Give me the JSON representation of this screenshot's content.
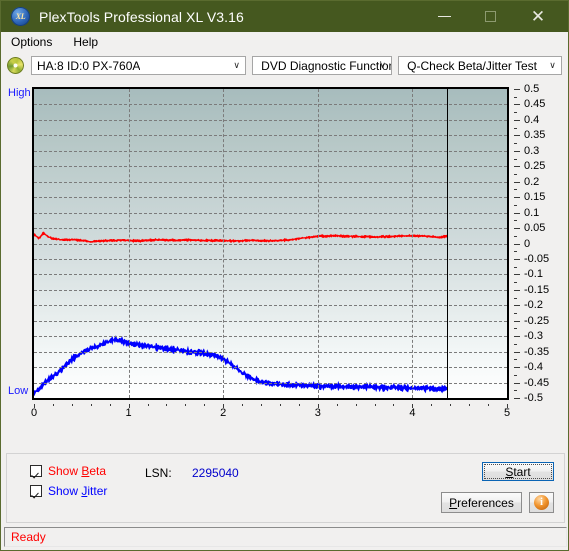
{
  "window": {
    "title": "PlexTools Professional XL V3.16",
    "app_icon": "xl-disc-icon",
    "icon_text": "XL",
    "minimize_label": "—",
    "maximize_label": "□",
    "close_label": "✕",
    "titlebar_color": "#45581f"
  },
  "menu": {
    "items": [
      {
        "label": "Options"
      },
      {
        "label": "Help"
      }
    ]
  },
  "toolbar": {
    "drive_icon": "disc-icon",
    "drive_select": {
      "value": "HA:8 ID:0  PX-760A",
      "arrow": "∨"
    },
    "function_select": {
      "value": "DVD Diagnostic Functions",
      "arrow": "∨"
    },
    "test_select": {
      "value": "Q-Check Beta/Jitter Test",
      "arrow": "∨"
    }
  },
  "chart_labels": {
    "high": "High",
    "low": "Low"
  },
  "chart_data": {
    "type": "line",
    "title": "Q-Check Beta/Jitter Test",
    "xlabel": "",
    "ylabel": "",
    "xlim": [
      0,
      5
    ],
    "ylim": [
      -0.5,
      0.5
    ],
    "grid": true,
    "legend_position": "below-left",
    "x_ticks": [
      0,
      1,
      2,
      3,
      4,
      5
    ],
    "x_tick_labels": [
      "0",
      "1",
      "2",
      "3",
      "4",
      "5"
    ],
    "y_ticks": [
      0.5,
      0.45,
      0.4,
      0.35,
      0.3,
      0.25,
      0.2,
      0.15,
      0.1,
      0.05,
      0,
      -0.05,
      -0.1,
      -0.15,
      -0.2,
      -0.25,
      -0.3,
      -0.35,
      -0.4,
      -0.45,
      -0.5
    ],
    "y_tick_labels": [
      "0.5",
      "0.45",
      "0.4",
      "0.35",
      "0.3",
      "0.25",
      "0.2",
      "0.15",
      "0.1",
      "0.05",
      "0",
      "-0.05",
      "-0.1",
      "-0.15",
      "-0.2",
      "-0.25",
      "-0.3",
      "-0.35",
      "-0.4",
      "-0.45",
      "-0.5"
    ],
    "data_end_x": 4.37,
    "annotations": [
      {
        "type": "vline",
        "x": 4.37,
        "color": "#000000",
        "label": "data end marker"
      }
    ],
    "series": [
      {
        "name": "Beta",
        "color": "#ff0000",
        "x": [
          0.0,
          0.05,
          0.1,
          0.15,
          0.2,
          0.3,
          0.4,
          0.5,
          0.6,
          0.7,
          0.8,
          0.9,
          1.0,
          1.1,
          1.2,
          1.3,
          1.4,
          1.5,
          1.6,
          1.7,
          1.8,
          1.9,
          2.0,
          2.1,
          2.2,
          2.3,
          2.4,
          2.5,
          2.6,
          2.7,
          2.8,
          2.9,
          3.0,
          3.1,
          3.2,
          3.3,
          3.4,
          3.5,
          3.6,
          3.7,
          3.8,
          3.9,
          4.0,
          4.1,
          4.2,
          4.3,
          4.37
        ],
        "values": [
          0.03,
          0.016,
          0.034,
          0.022,
          0.016,
          0.012,
          0.013,
          0.01,
          0.006,
          0.008,
          0.009,
          0.011,
          0.01,
          0.008,
          0.01,
          0.012,
          0.011,
          0.01,
          0.012,
          0.011,
          0.01,
          0.01,
          0.009,
          0.008,
          0.009,
          0.01,
          0.009,
          0.008,
          0.01,
          0.012,
          0.016,
          0.02,
          0.023,
          0.024,
          0.025,
          0.024,
          0.023,
          0.022,
          0.021,
          0.022,
          0.023,
          0.024,
          0.025,
          0.024,
          0.022,
          0.02,
          0.024
        ],
        "noise_amplitude": 0.011
      },
      {
        "name": "Jitter",
        "color": "#0000ff",
        "x": [
          0.0,
          0.05,
          0.1,
          0.15,
          0.2,
          0.25,
          0.3,
          0.35,
          0.4,
          0.45,
          0.5,
          0.55,
          0.6,
          0.65,
          0.7,
          0.75,
          0.8,
          0.85,
          0.9,
          0.95,
          1.0,
          1.1,
          1.2,
          1.3,
          1.4,
          1.5,
          1.6,
          1.7,
          1.8,
          1.9,
          2.0,
          2.1,
          2.2,
          2.3,
          2.4,
          2.5,
          2.6,
          2.7,
          2.8,
          2.9,
          3.0,
          3.1,
          3.2,
          3.3,
          3.4,
          3.5,
          3.6,
          3.7,
          3.8,
          3.9,
          4.0,
          4.1,
          4.2,
          4.3,
          4.37
        ],
        "values": [
          -0.485,
          -0.47,
          -0.455,
          -0.44,
          -0.43,
          -0.42,
          -0.405,
          -0.39,
          -0.375,
          -0.365,
          -0.355,
          -0.348,
          -0.34,
          -0.335,
          -0.328,
          -0.322,
          -0.316,
          -0.312,
          -0.315,
          -0.318,
          -0.322,
          -0.328,
          -0.332,
          -0.336,
          -0.34,
          -0.344,
          -0.348,
          -0.352,
          -0.356,
          -0.362,
          -0.372,
          -0.395,
          -0.418,
          -0.436,
          -0.448,
          -0.452,
          -0.455,
          -0.458,
          -0.458,
          -0.46,
          -0.462,
          -0.462,
          -0.462,
          -0.463,
          -0.464,
          -0.464,
          -0.465,
          -0.466,
          -0.466,
          -0.467,
          -0.468,
          -0.468,
          -0.469,
          -0.47,
          -0.47
        ],
        "noise_amplitude": 0.03
      }
    ]
  },
  "controls": {
    "show_beta": {
      "label_pre": "Show ",
      "label_key": "B",
      "label_post": "eta",
      "checked": true
    },
    "show_jitter": {
      "label_pre": "Show ",
      "label_key": "J",
      "label_post": "itter",
      "checked": true
    },
    "lsn_label": "LSN:",
    "lsn_value": "2295040",
    "start_button": {
      "pre": "",
      "key": "S",
      "post": "tart"
    },
    "preferences_button": {
      "pre": "",
      "key": "P",
      "post": "references"
    },
    "info_button": {
      "icon": "info-icon",
      "glyph": "i"
    }
  },
  "status": {
    "text": "Ready",
    "color": "#ff0000"
  }
}
